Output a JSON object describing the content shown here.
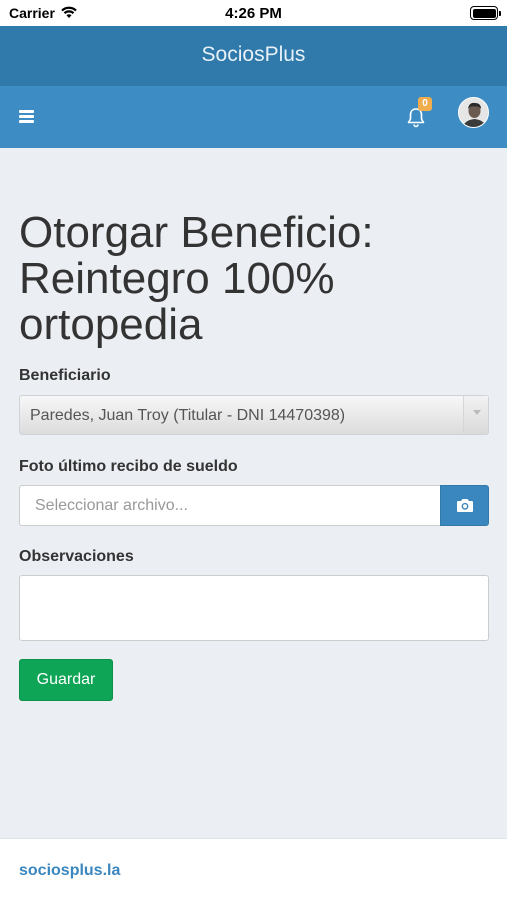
{
  "status_bar": {
    "carrier": "Carrier",
    "time": "4:26 PM"
  },
  "header": {
    "app_title": "SociosPlus",
    "notifications_count": "0"
  },
  "page": {
    "title": "Otorgar Beneficio: Reintegro 100% ortopedia"
  },
  "form": {
    "beneficiary_label": "Beneficiario",
    "beneficiary_value": "Paredes, Juan Troy (Titular - DNI 14470398)",
    "receipt_label": "Foto último recibo de sueldo",
    "receipt_placeholder": "Seleccionar archivo...",
    "observations_label": "Observaciones",
    "observations_value": "",
    "save_label": "Guardar"
  },
  "footer": {
    "link": "sociosplus.la"
  },
  "icons": {
    "menu": "hamburger-menu-icon",
    "notifications": "bell-icon",
    "file": "camera-icon",
    "wifi": "wifi-icon",
    "battery": "battery-icon"
  },
  "colors": {
    "title_bar": "#2f7aab",
    "nav_bar": "#3d8dc4",
    "accent": "#3a87bf",
    "save": "#0fa557",
    "badge": "#f0ad4e",
    "background": "#ebeef3"
  }
}
